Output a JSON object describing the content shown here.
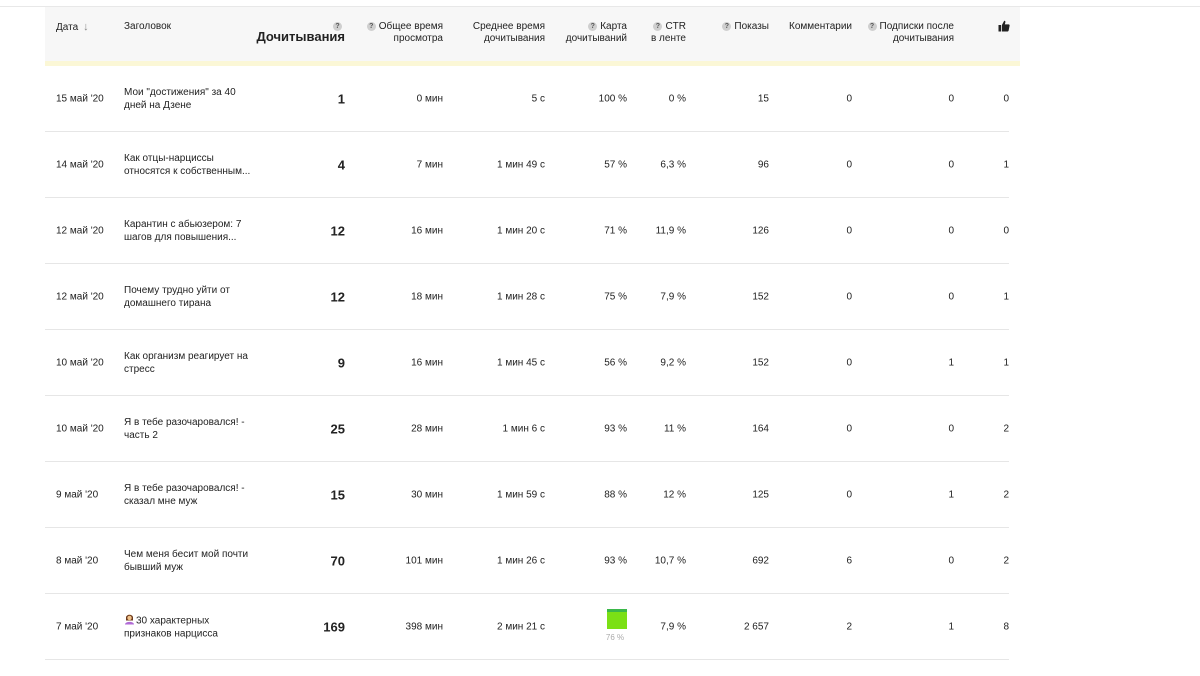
{
  "header": {
    "date": "Дата",
    "title": "Заголовок",
    "reads": "Дочитывания",
    "total_time_1": "Общее время",
    "total_time_2": "просмотра",
    "avg_time_1": "Среднее время",
    "avg_time_2": "дочитывания",
    "map_1": "Карта",
    "map_2": "дочитываний",
    "ctr_1": "CTR",
    "ctr_2": "в ленте",
    "shows": "Показы",
    "comments": "Комментарии",
    "subs_1": "Подписки после",
    "subs_2": "дочитывания",
    "help_mark": "?",
    "sort_icon": "arrow-down-icon",
    "likes_icon": "thumbs-up-icon"
  },
  "rows": [
    {
      "date": "15 май '20",
      "title": "Мои \"достижения\" за 40 дней на Дзене",
      "reads": "1",
      "total_time": "0 мин",
      "avg_time": "5 с",
      "map": "100 %",
      "ctr": "0 %",
      "shows": "15",
      "comments": "0",
      "subs": "0",
      "likes": "0"
    },
    {
      "date": "14 май '20",
      "title": "Как отцы-нарциссы относятся к собственным...",
      "reads": "4",
      "total_time": "7 мин",
      "avg_time": "1 мин 49 с",
      "map": "57 %",
      "ctr": "6,3 %",
      "shows": "96",
      "comments": "0",
      "subs": "0",
      "likes": "1"
    },
    {
      "date": "12 май '20",
      "title": "Карантин с абьюзером: 7 шагов для повышения...",
      "reads": "12",
      "total_time": "16 мин",
      "avg_time": "1 мин 20 с",
      "map": "71 %",
      "ctr": "11,9 %",
      "shows": "126",
      "comments": "0",
      "subs": "0",
      "likes": "0"
    },
    {
      "date": "12 май '20",
      "title": "Почему трудно уйти от домашнего тирана",
      "reads": "12",
      "total_time": "18 мин",
      "avg_time": "1 мин 28 с",
      "map": "75 %",
      "ctr": "7,9 %",
      "shows": "152",
      "comments": "0",
      "subs": "0",
      "likes": "1"
    },
    {
      "date": "10 май '20",
      "title": "Как организм реагирует на стресс",
      "reads": "9",
      "total_time": "16 мин",
      "avg_time": "1 мин 45 с",
      "map": "56 %",
      "ctr": "9,2 %",
      "shows": "152",
      "comments": "0",
      "subs": "1",
      "likes": "1"
    },
    {
      "date": "10 май '20",
      "title": "Я в тебе разочаровался! - часть 2",
      "reads": "25",
      "total_time": "28 мин",
      "avg_time": "1 мин 6 с",
      "map": "93 %",
      "ctr": "11 %",
      "shows": "164",
      "comments": "0",
      "subs": "0",
      "likes": "2"
    },
    {
      "date": "9 май '20",
      "title": "Я в тебе разочаровался! - сказал мне муж",
      "reads": "15",
      "total_time": "30 мин",
      "avg_time": "1 мин 59 с",
      "map": "88 %",
      "ctr": "12 %",
      "shows": "125",
      "comments": "0",
      "subs": "1",
      "likes": "2"
    },
    {
      "date": "8 май '20",
      "title": "Чем меня бесит мой почти бывший муж",
      "reads": "70",
      "total_time": "101 мин",
      "avg_time": "1 мин 26 с",
      "map": "93 %",
      "ctr": "10,7 %",
      "shows": "692",
      "comments": "6",
      "subs": "0",
      "likes": "2"
    },
    {
      "date": "7 май '20",
      "title": "30 характерных признаков нарцисса",
      "title_icon": "woman-shrugging-emoji-icon",
      "reads": "169",
      "total_time": "398 мин",
      "avg_time": "2 мин 21 с",
      "map": "76 %",
      "map_fill": 0.76,
      "map_style": "bar",
      "ctr": "7,9 %",
      "shows": "2 657",
      "comments": "2",
      "subs": "1",
      "likes": "8"
    }
  ],
  "colors": {
    "header_bg": "#f7f7f7",
    "header_strip": "#fbf7d6",
    "bar_fill": "#7be015",
    "bar_top": "#3bb84a",
    "divider": "#e6e6e6"
  }
}
